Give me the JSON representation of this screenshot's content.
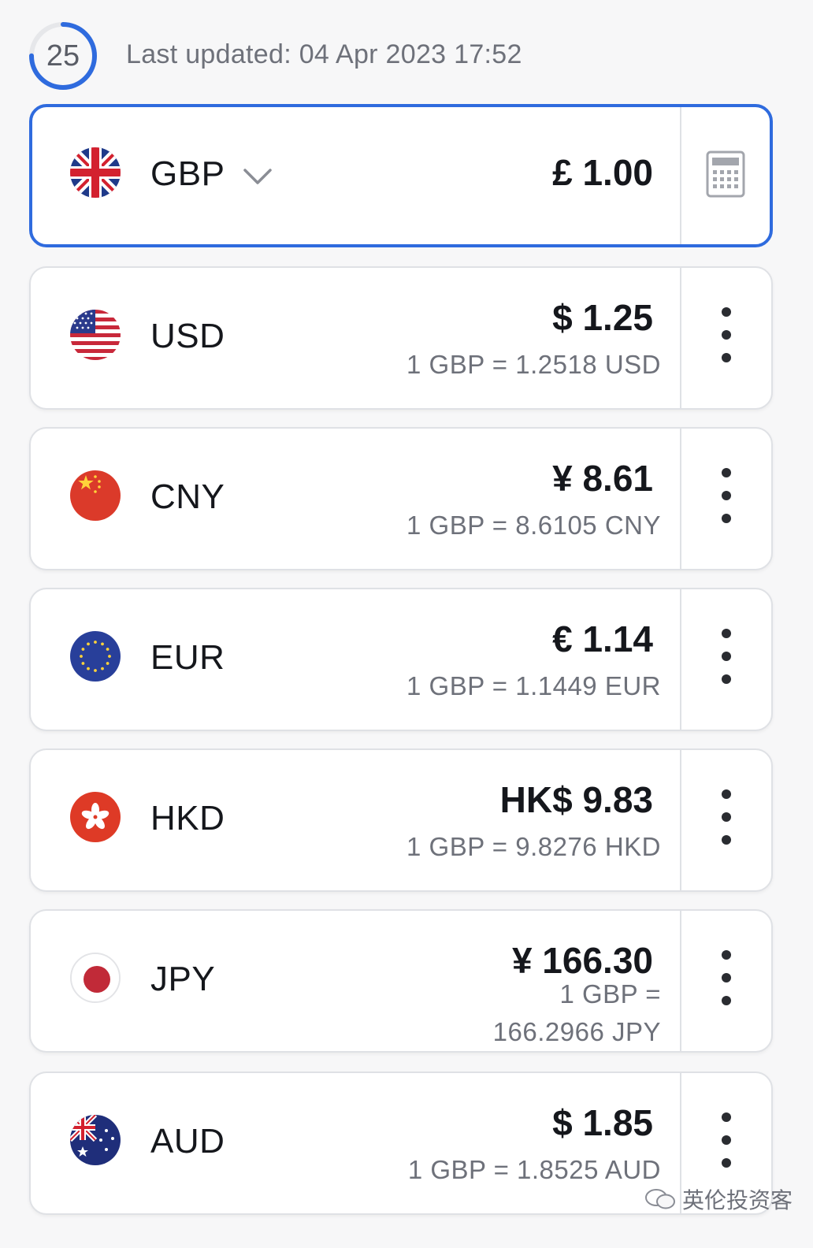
{
  "header": {
    "timer_value": "25",
    "timer_progress": 0.75,
    "last_updated": "Last updated: 04 Apr 2023 17:52"
  },
  "base": {
    "code": "GBP",
    "amount": "£ 1.00",
    "flag": "uk-flag-icon"
  },
  "rows": [
    {
      "code": "USD",
      "amount": "$ 1.25",
      "rate": "1 GBP = 1.2518 USD",
      "flag": "us-flag-icon"
    },
    {
      "code": "CNY",
      "amount": "¥ 8.61",
      "rate": "1 GBP = 8.6105 CNY",
      "flag": "china-flag-icon"
    },
    {
      "code": "EUR",
      "amount": "€ 1.14",
      "rate": "1 GBP = 1.1449 EUR",
      "flag": "eu-flag-icon"
    },
    {
      "code": "HKD",
      "amount": "HK$ 9.83",
      "rate": "1 GBP = 9.8276 HKD",
      "flag": "hong-kong-flag-icon"
    },
    {
      "code": "JPY",
      "amount": "¥ 166.30",
      "rate": "1 GBP = 166.2966 JPY",
      "flag": "japan-flag-icon"
    },
    {
      "code": "AUD",
      "amount": "$ 1.85",
      "rate": "1 GBP = 1.8525 AUD",
      "flag": "australia-flag-icon"
    }
  ],
  "watermark": "英伦投资客",
  "colors": {
    "accent": "#2f6bde",
    "card_border": "#dfe1e5",
    "text_secondary": "#6e717a"
  }
}
